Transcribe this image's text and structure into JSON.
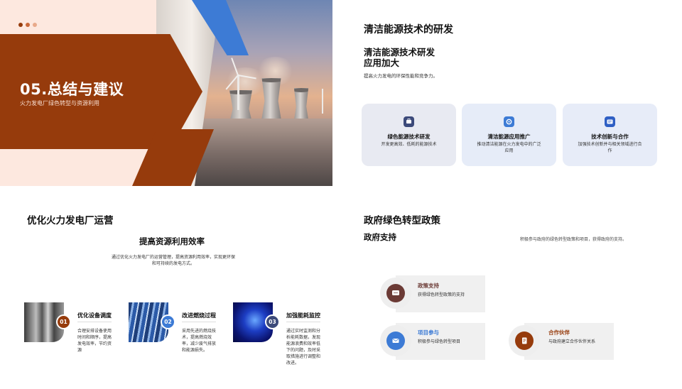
{
  "slide1": {
    "title": "05.总结与建议",
    "subtitle": "火力发电厂绿色转型与资源利用",
    "dot_colors": [
      "#963b0c",
      "#c9683a",
      "#e8a98a"
    ],
    "accent_orange": "#963b0c",
    "accent_blue": "#3d7bd5"
  },
  "slide2": {
    "heading": "清洁能源技术的研发",
    "title": "清洁能源技术研发应用加大",
    "description": "提高火力发电的环保性能和竞争力。",
    "cards": [
      {
        "icon": "briefcase-icon",
        "title": "绿色能源技术研发",
        "desc": "开发更高效、低耗的能源技术",
        "bg": "#e8eaf2",
        "icon_color": "#3c4a7a"
      },
      {
        "icon": "gear-icon",
        "title": "清洁能源应用推广",
        "desc": "推动清洁能源在火力发电中的广泛应用",
        "bg": "#e6ecf8",
        "icon_color": "#3d7bd5"
      },
      {
        "icon": "chat-icon",
        "title": "技术创新与合作",
        "desc": "加强技术创新并与相关领域进行合作",
        "bg": "#e7ecf8",
        "icon_color": "#2f5fc4"
      }
    ]
  },
  "slide3": {
    "heading": "优化火力发电厂运营",
    "title": "提高资源利用效率",
    "description": "通过优化火力发电厂的运营管理，提高资源利用效率，实现更环保和可持续的发电方式。",
    "features": [
      {
        "num": "01",
        "title": "优化设备调度",
        "desc": "合理安排设备使用时间和顺序，提高发电效率，节约资源",
        "num_color": "#963b0c",
        "image": "buildings-image"
      },
      {
        "num": "02",
        "title": "改进燃烧过程",
        "desc": "采用先进的燃烧技术，提高燃烧效率，减少废气排放和能源损失。",
        "num_color": "#3d7bd5",
        "image": "blue-tech-image"
      },
      {
        "num": "03",
        "title": "加强能耗监控",
        "desc": "通过实时监测和分析能耗数据，发现能源浪费和效率低下的问题，及时采取措施进行调整和改进。",
        "num_color": "#3c4a7a",
        "image": "blue-lights-image"
      }
    ]
  },
  "slide4": {
    "heading": "政府绿色转型政策",
    "subtitle": "政府支持",
    "description": "积极参与政府的绿色转型政策和项目，获得政府的支持。",
    "items": [
      {
        "icon": "chat-bubble-icon",
        "title": "政策支持",
        "desc": "获得绿色转型政策的支持",
        "color": "#6b3a35",
        "title_color": "#6b3a35"
      },
      {
        "icon": "mail-icon",
        "title": "项目参与",
        "desc": "积极参与绿色转型项目",
        "color": "#3d7bd5",
        "title_color": "#3d7bd5"
      },
      {
        "icon": "document-icon",
        "title": "合作伙伴",
        "desc": "与政府建立合作伙伴关系",
        "color": "#963b0c",
        "title_color": "#963b0c"
      }
    ]
  }
}
